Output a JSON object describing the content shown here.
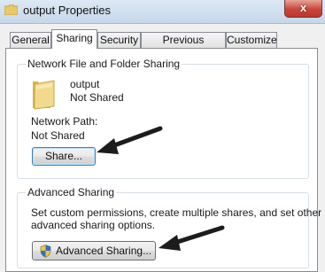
{
  "window": {
    "title": "output Properties",
    "close_glyph": "x"
  },
  "tabs": [
    {
      "label": "General",
      "active": false
    },
    {
      "label": "Sharing",
      "active": true
    },
    {
      "label": "Security",
      "active": false
    },
    {
      "label": "Previous Versions",
      "active": false
    },
    {
      "label": "Customize",
      "active": false
    }
  ],
  "network_sharing": {
    "group_title": "Network File and Folder Sharing",
    "folder_name": "output",
    "folder_status": "Not Shared",
    "path_label": "Network Path:",
    "path_value": "Not Shared",
    "share_button": "Share..."
  },
  "advanced_sharing": {
    "group_title": "Advanced Sharing",
    "description_line1": "Set custom permissions, create multiple shares, and set other",
    "description_line2": "advanced sharing options.",
    "button_label": "Advanced Sharing..."
  },
  "icons": {
    "title_icon": "folder-icon",
    "folder_icon": "folder-icon",
    "shield_icon": "uac-shield-icon",
    "annotation": "arrow-icon"
  },
  "colors": {
    "close_button": "#c9473a",
    "focus_border": "#3c7fb1",
    "folder": "#e8c96a"
  }
}
